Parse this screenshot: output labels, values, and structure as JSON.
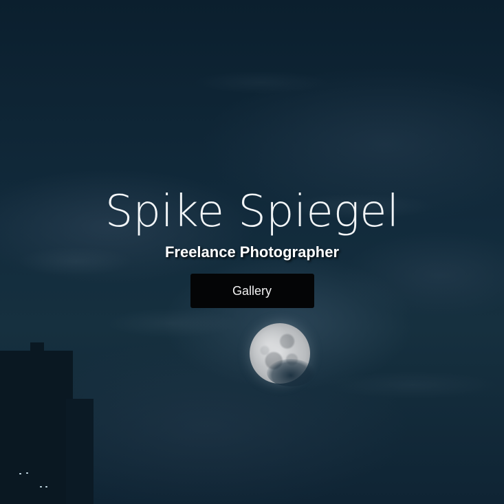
{
  "hero": {
    "title": "Spike Spiegel",
    "subtitle": "Freelance Photographer",
    "gallery_button_label": "Gallery"
  },
  "colors": {
    "sky": "#122b3c",
    "title_text": "#f2f5f7",
    "button_bg": "#040506",
    "button_text": "#f1f1f1"
  },
  "background_elements": [
    "night-sky",
    "clouds",
    "full-moon",
    "building-silhouette"
  ]
}
